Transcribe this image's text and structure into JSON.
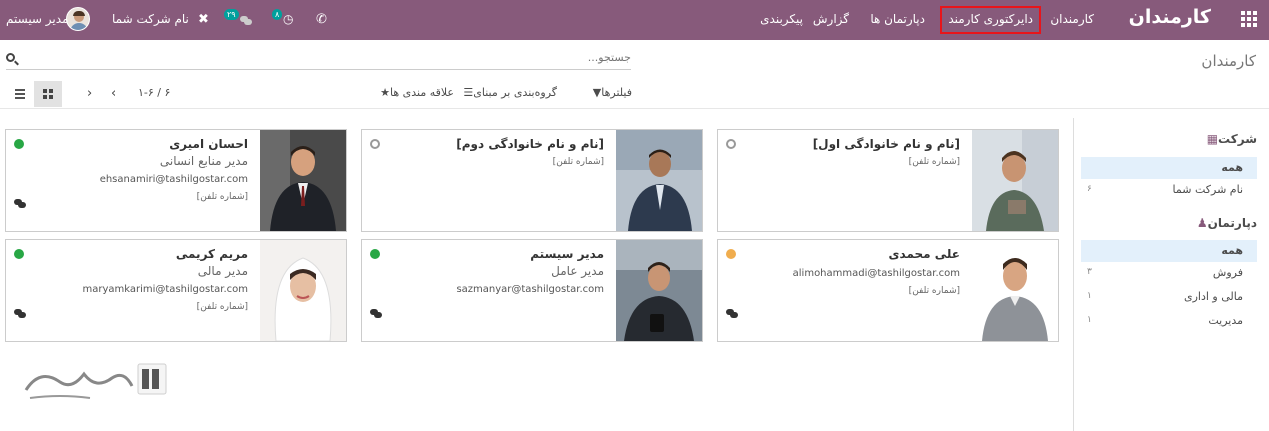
{
  "navbar": {
    "brand": "کارمندان",
    "menus": [
      "کارمندان",
      "دایرکتوری کارمند",
      "دپارتمان ها",
      "گزارش",
      "پیکربندی"
    ],
    "active_menu": "دایرکتوری کارمند",
    "company": "نام شرکت شما",
    "user": "مدیر سیستم",
    "activity_count": "۸",
    "message_count": "۲۹",
    "colors": {
      "bar": "#875a7b",
      "badge": "#00a09d",
      "highlight": "#e8141a"
    }
  },
  "control": {
    "title": "کارمندان",
    "search_placeholder": "جستجو...",
    "filters_label": "فیلترها",
    "groupby_label": "گروه‌بندی بر مبنای",
    "favorites_label": "علاقه مندی ها",
    "pager": "۱-۶ / ۶"
  },
  "sidebar": {
    "company_title": "شرکت",
    "company_items": [
      {
        "label": "همه",
        "count": ""
      },
      {
        "label": "نام شرکت شما",
        "count": "۶"
      }
    ],
    "department_title": "دپارتمان",
    "department_items": [
      {
        "label": "همه",
        "count": ""
      },
      {
        "label": "فروش",
        "count": "۳"
      },
      {
        "label": "مالی و اداری",
        "count": "۱"
      },
      {
        "label": "مدیریت",
        "count": "۱"
      }
    ]
  },
  "cards": [
    {
      "name": "[نام و نام خانوادگی اول]",
      "job": "",
      "email": "",
      "phone": "[شماره تلفن]",
      "status": "offline"
    },
    {
      "name": "[نام و نام خانوادگی دوم]",
      "job": "",
      "email": "",
      "phone": "[شماره تلفن]",
      "status": "offline"
    },
    {
      "name": "احسان امیری",
      "job": "مدیر منابع انسانی",
      "email": "ehsanamiri@tashilgostar.com",
      "phone": "[شماره تلفن]",
      "status": "online"
    },
    {
      "name": "علی محمدی",
      "job": "",
      "email": "alimohammadi@tashilgostar.com",
      "phone": "[شماره تلفن]",
      "status": "away"
    },
    {
      "name": "مدیر سیستم",
      "job": "مدیر عامل",
      "email": "sazmanyar@tashilgostar.com",
      "phone": "",
      "status": "online"
    },
    {
      "name": "مریم کریمی",
      "job": "مدیر مالی",
      "email": "maryamkarimi@tashilgostar.com",
      "phone": "[شماره تلفن]",
      "status": "online"
    }
  ],
  "status_colors": {
    "online": "#28a745",
    "away": "#f0ad4e",
    "offline": "#ffffff"
  }
}
